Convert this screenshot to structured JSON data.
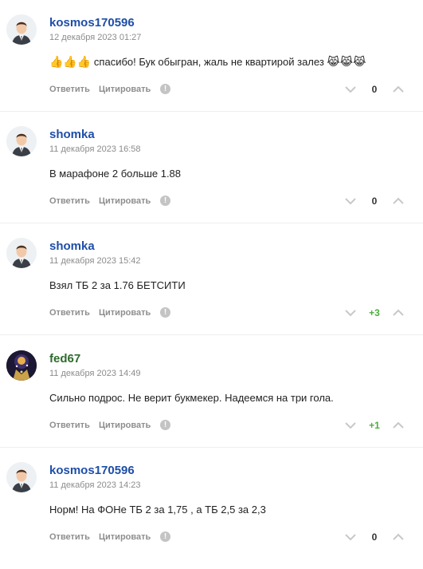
{
  "colors": {
    "username_blue": "#1e4ea8",
    "username_green": "#2e6b2e",
    "score_neutral": "#333333",
    "score_positive": "#4caf3e",
    "action_gray": "#8e8e8e",
    "timestamp_gray": "#8c8c8c"
  },
  "comments": [
    {
      "username": "kosmos170596",
      "timestamp": "12 декабря 2023 01:27",
      "prefix_emoji": "👍👍👍",
      "text": "спасибо! Бук обыгран, жаль не квартирой залез",
      "suffix_emoji": "😹😹😹",
      "reply_label": "Ответить",
      "quote_label": "Цитировать",
      "report_label": "!",
      "score": "0",
      "avatar_icon": "default-man-avatar-icon"
    },
    {
      "username": "shomka",
      "timestamp": "11 декабря 2023 16:58",
      "prefix_emoji": "",
      "text": "В марафоне 2 больше 1.88",
      "suffix_emoji": "",
      "reply_label": "Ответить",
      "quote_label": "Цитировать",
      "report_label": "!",
      "score": "0",
      "avatar_icon": "default-man-avatar-icon"
    },
    {
      "username": "shomka",
      "timestamp": "11 декабря 2023 15:42",
      "prefix_emoji": "",
      "text": "Взял ТБ 2 за 1.76 БЕТСИТИ",
      "suffix_emoji": "",
      "reply_label": "Ответить",
      "quote_label": "Цитировать",
      "report_label": "!",
      "score": "+3",
      "avatar_icon": "default-man-avatar-icon"
    },
    {
      "username": "fed67",
      "timestamp": "11 декабря 2023 14:49",
      "prefix_emoji": "",
      "text": "Сильно подрос. Не верит букмекер. Надеемся на три гола.",
      "suffix_emoji": "",
      "reply_label": "Ответить",
      "quote_label": "Цитировать",
      "report_label": "!",
      "score": "+1",
      "avatar_icon": "custom-photo-avatar-icon"
    },
    {
      "username": "kosmos170596",
      "timestamp": "11 декабря 2023 14:23",
      "prefix_emoji": "",
      "text": "Норм! На ФОНе ТБ 2 за 1,75 , а ТБ 2,5 за 2,3",
      "suffix_emoji": "",
      "reply_label": "Ответить",
      "quote_label": "Цитировать",
      "report_label": "!",
      "score": "0",
      "avatar_icon": "default-man-avatar-icon"
    }
  ]
}
